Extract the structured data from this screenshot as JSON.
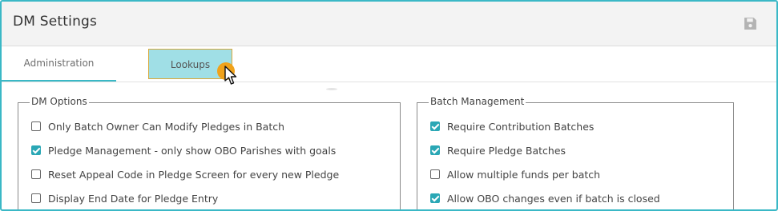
{
  "header": {
    "title": "DM Settings",
    "save_icon": "save-icon"
  },
  "tabs": [
    {
      "label": "Administration",
      "active": true
    },
    {
      "label": "Lookups",
      "active": false,
      "highlighted": true
    }
  ],
  "dm_options": {
    "legend": "DM Options",
    "items": [
      {
        "label": "Only Batch Owner Can Modify Pledges in Batch",
        "checked": false
      },
      {
        "label": "Pledge Management - only show OBO Parishes with goals",
        "checked": true
      },
      {
        "label": "Reset Appeal Code in Pledge Screen for every new Pledge",
        "checked": false
      },
      {
        "label": "Display End Date for Pledge Entry",
        "checked": false
      }
    ]
  },
  "batch_management": {
    "legend": "Batch Management",
    "items": [
      {
        "label": "Require Contribution Batches",
        "checked": true
      },
      {
        "label": "Require Pledge Batches",
        "checked": true
      },
      {
        "label": "Allow multiple funds per batch",
        "checked": false
      },
      {
        "label": "Allow OBO changes even if batch is closed",
        "checked": true
      }
    ]
  },
  "colors": {
    "accent": "#3ab8c6",
    "checkbox": "#2aa7b5",
    "highlight_tab": "#a0dfe6",
    "cursor_dot": "#f0a21a"
  }
}
